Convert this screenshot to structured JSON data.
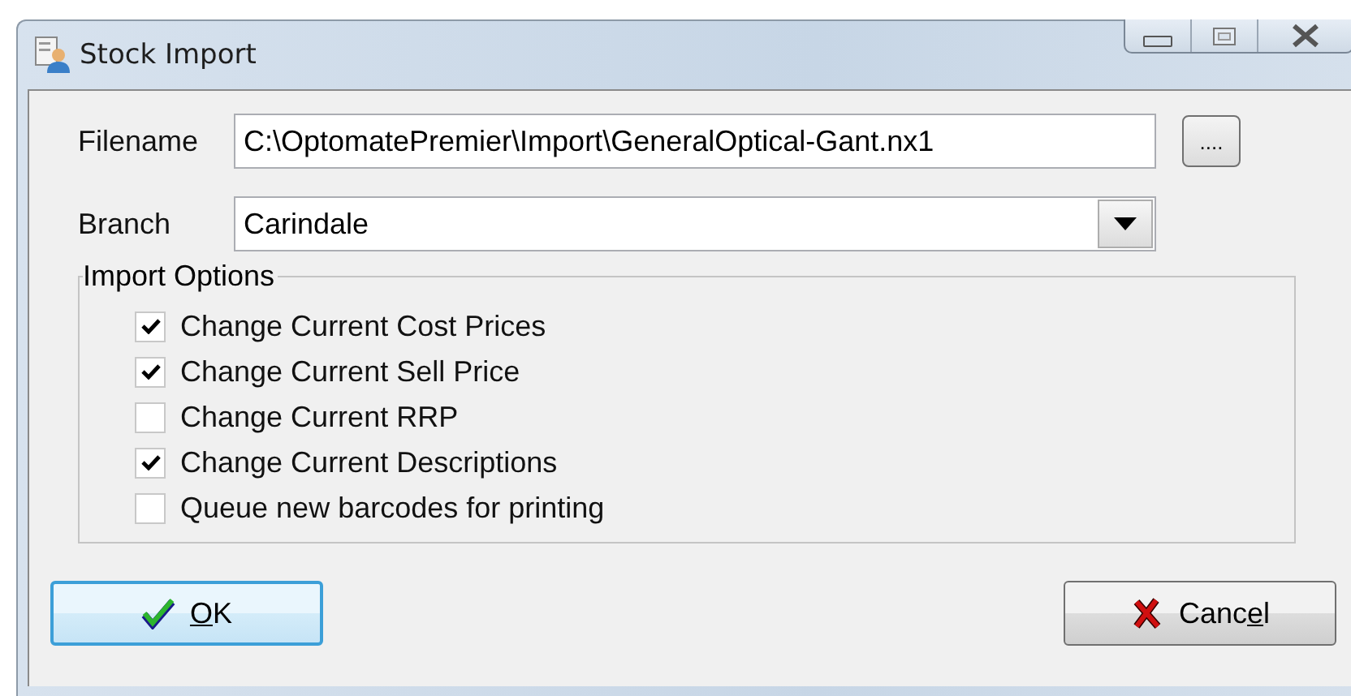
{
  "window": {
    "title": "Stock Import"
  },
  "filename": {
    "label": "Filename",
    "value": "C:\\OptomatePremier\\Import\\GeneralOptical-Gant.nx1",
    "browse_button": "...."
  },
  "branch": {
    "label": "Branch",
    "value": "Carindale"
  },
  "import_options": {
    "title": "Import Options",
    "options": [
      {
        "label": "Change Current Cost Prices",
        "checked": true
      },
      {
        "label": "Change Current Sell Price",
        "checked": true
      },
      {
        "label": "Change Current RRP",
        "checked": false
      },
      {
        "label": "Change Current Descriptions",
        "checked": true
      },
      {
        "label": "Queue new barcodes for printing",
        "checked": false
      }
    ]
  },
  "buttons": [
    {
      "kind": "ok",
      "label_parts": {
        "key": "O",
        "after": "K"
      },
      "focused": true
    },
    {
      "kind": "cancel",
      "label_parts": {
        "before": "Canc",
        "key": "e",
        "after": "l"
      },
      "focused": false
    }
  ]
}
